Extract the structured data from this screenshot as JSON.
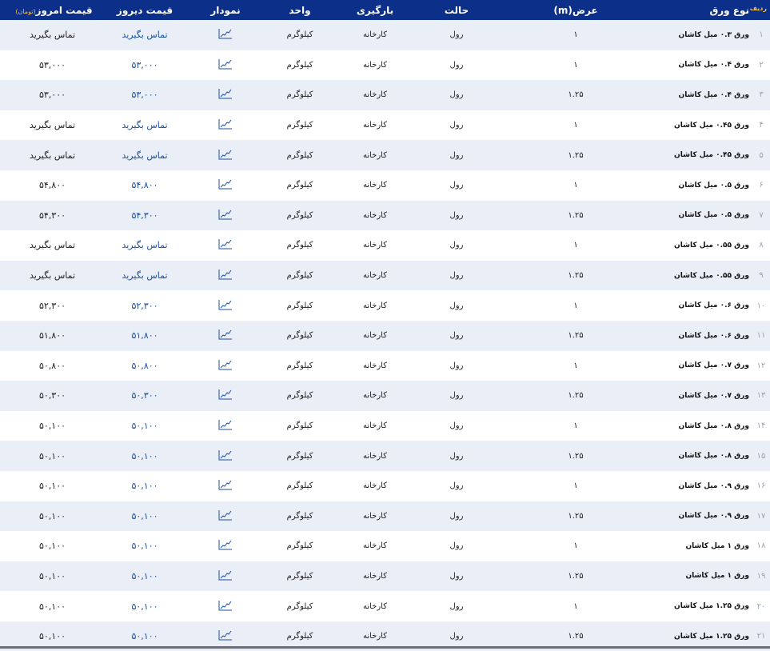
{
  "header": {
    "index": "ردیف",
    "name": "نوع ورق",
    "width": "عرض(m)",
    "state": "حالت",
    "loading": "بارگیری",
    "unit": "واحد",
    "chart": "نمودار",
    "yesterday": "قیمت دیروز",
    "today": "قیمت امروز",
    "today_unit": "(تومان)"
  },
  "colors": {
    "header_bg": "#0c2f8a",
    "alt_row": "#e9eef7",
    "link": "#1a4fa0",
    "accent": "#f5c242"
  },
  "rows": [
    {
      "idx": "۱",
      "name": "ورق ۰.۳ میل کاشان",
      "width": "۱",
      "state": "رول",
      "loading": "کارخانه",
      "unit": "کیلوگرم",
      "yesterday": "تماس بگیرید",
      "today": "تماس بگیرید"
    },
    {
      "idx": "۲",
      "name": "ورق ۰.۴ میل کاشان",
      "width": "۱",
      "state": "رول",
      "loading": "کارخانه",
      "unit": "کیلوگرم",
      "yesterday": "۵۳,۰۰۰",
      "today": "۵۳,۰۰۰"
    },
    {
      "idx": "۳",
      "name": "ورق ۰.۴ میل کاشان",
      "width": "۱.۲۵",
      "state": "رول",
      "loading": "کارخانه",
      "unit": "کیلوگرم",
      "yesterday": "۵۳,۰۰۰",
      "today": "۵۳,۰۰۰"
    },
    {
      "idx": "۴",
      "name": "ورق ۰.۴۵ میل کاشان",
      "width": "۱",
      "state": "رول",
      "loading": "کارخانه",
      "unit": "کیلوگرم",
      "yesterday": "تماس بگیرید",
      "today": "تماس بگیرید"
    },
    {
      "idx": "۵",
      "name": "ورق ۰.۴۵ میل کاشان",
      "width": "۱.۲۵",
      "state": "رول",
      "loading": "کارخانه",
      "unit": "کیلوگرم",
      "yesterday": "تماس بگیرید",
      "today": "تماس بگیرید"
    },
    {
      "idx": "۶",
      "name": "ورق ۰.۵ میل کاشان",
      "width": "۱",
      "state": "رول",
      "loading": "کارخانه",
      "unit": "کیلوگرم",
      "yesterday": "۵۴,۸۰۰",
      "today": "۵۴,۸۰۰"
    },
    {
      "idx": "۷",
      "name": "ورق ۰.۵ میل کاشان",
      "width": "۱.۲۵",
      "state": "رول",
      "loading": "کارخانه",
      "unit": "کیلوگرم",
      "yesterday": "۵۴,۳۰۰",
      "today": "۵۴,۳۰۰"
    },
    {
      "idx": "۸",
      "name": "ورق ۰.۵۵ میل کاشان",
      "width": "۱",
      "state": "رول",
      "loading": "کارخانه",
      "unit": "کیلوگرم",
      "yesterday": "تماس بگیرید",
      "today": "تماس بگیرید"
    },
    {
      "idx": "۹",
      "name": "ورق ۰.۵۵ میل کاشان",
      "width": "۱.۲۵",
      "state": "رول",
      "loading": "کارخانه",
      "unit": "کیلوگرم",
      "yesterday": "تماس بگیرید",
      "today": "تماس بگیرید"
    },
    {
      "idx": "۱۰",
      "name": "ورق ۰.۶ میل کاشان",
      "width": "۱",
      "state": "رول",
      "loading": "کارخانه",
      "unit": "کیلوگرم",
      "yesterday": "۵۲,۳۰۰",
      "today": "۵۲,۳۰۰"
    },
    {
      "idx": "۱۱",
      "name": "ورق ۰.۶ میل کاشان",
      "width": "۱.۲۵",
      "state": "رول",
      "loading": "کارخانه",
      "unit": "کیلوگرم",
      "yesterday": "۵۱,۸۰۰",
      "today": "۵۱,۸۰۰"
    },
    {
      "idx": "۱۲",
      "name": "ورق ۰.۷ میل کاشان",
      "width": "۱",
      "state": "رول",
      "loading": "کارخانه",
      "unit": "کیلوگرم",
      "yesterday": "۵۰,۸۰۰",
      "today": "۵۰,۸۰۰"
    },
    {
      "idx": "۱۳",
      "name": "ورق ۰.۷ میل کاشان",
      "width": "۱.۲۵",
      "state": "رول",
      "loading": "کارخانه",
      "unit": "کیلوگرم",
      "yesterday": "۵۰,۳۰۰",
      "today": "۵۰,۳۰۰"
    },
    {
      "idx": "۱۴",
      "name": "ورق ۰.۸ میل کاشان",
      "width": "۱",
      "state": "رول",
      "loading": "کارخانه",
      "unit": "کیلوگرم",
      "yesterday": "۵۰,۱۰۰",
      "today": "۵۰,۱۰۰"
    },
    {
      "idx": "۱۵",
      "name": "ورق ۰.۸ میل کاشان",
      "width": "۱.۲۵",
      "state": "رول",
      "loading": "کارخانه",
      "unit": "کیلوگرم",
      "yesterday": "۵۰,۱۰۰",
      "today": "۵۰,۱۰۰"
    },
    {
      "idx": "۱۶",
      "name": "ورق ۰.۹ میل کاشان",
      "width": "۱",
      "state": "رول",
      "loading": "کارخانه",
      "unit": "کیلوگرم",
      "yesterday": "۵۰,۱۰۰",
      "today": "۵۰,۱۰۰"
    },
    {
      "idx": "۱۷",
      "name": "ورق ۰.۹ میل کاشان",
      "width": "۱.۲۵",
      "state": "رول",
      "loading": "کارخانه",
      "unit": "کیلوگرم",
      "yesterday": "۵۰,۱۰۰",
      "today": "۵۰,۱۰۰"
    },
    {
      "idx": "۱۸",
      "name": "ورق ۱ میل کاشان",
      "width": "۱",
      "state": "رول",
      "loading": "کارخانه",
      "unit": "کیلوگرم",
      "yesterday": "۵۰,۱۰۰",
      "today": "۵۰,۱۰۰"
    },
    {
      "idx": "۱۹",
      "name": "ورق ۱ میل کاشان",
      "width": "۱.۲۵",
      "state": "رول",
      "loading": "کارخانه",
      "unit": "کیلوگرم",
      "yesterday": "۵۰,۱۰۰",
      "today": "۵۰,۱۰۰"
    },
    {
      "idx": "۲۰",
      "name": "ورق ۱.۲۵ میل کاشان",
      "width": "۱",
      "state": "رول",
      "loading": "کارخانه",
      "unit": "کیلوگرم",
      "yesterday": "۵۰,۱۰۰",
      "today": "۵۰,۱۰۰"
    },
    {
      "idx": "۲۱",
      "name": "ورق ۱.۲۵ میل کاشان",
      "width": "۱.۲۵",
      "state": "رول",
      "loading": "کارخانه",
      "unit": "کیلوگرم",
      "yesterday": "۵۰,۱۰۰",
      "today": "۵۰,۱۰۰"
    }
  ]
}
